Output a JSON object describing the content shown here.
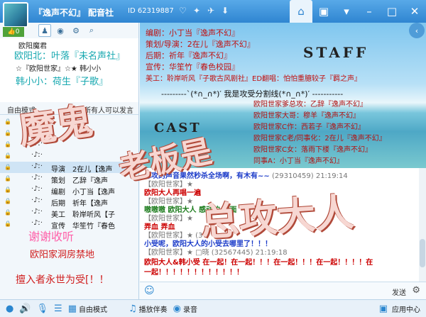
{
  "titlebar": {
    "title": "『逸声不幻』",
    "subtitle": "配音社",
    "id": "ID 62319887"
  },
  "left": {
    "like": "0",
    "header": {
      "line1": "欧阳魔君",
      "line2": "欧阳北：叶落『未名声社』",
      "line3": "☆『欧阳世家』☆★ 韩小小",
      "line4": "韩小小：荷生『子歌』"
    },
    "mode": {
      "left": "自由模式",
      "right": "所有人可以发言"
    },
    "members": [
      {
        "mark": "·♪ː·",
        "role": "",
        "nick": ""
      },
      {
        "mark": "·♪ː·",
        "role": "",
        "nick": ""
      },
      {
        "mark": "·♪ː·",
        "role": "",
        "nick": ""
      },
      {
        "mark": "·♪ː·",
        "role": "",
        "nick": ""
      },
      {
        "mark": "·♪ː·",
        "role": "导演",
        "nick": "2在儿【逸声"
      },
      {
        "mark": "·♪ː·",
        "role": "策划",
        "nick": "乙辞『逸声"
      },
      {
        "mark": "·♪ː·",
        "role": "编剧",
        "nick": "小丁当【逸声"
      },
      {
        "mark": "·♪ː·",
        "role": "后期",
        "nick": "祈年【逸声"
      },
      {
        "mark": "·♪ː·",
        "role": "美工",
        "nick": "聆岸听风【子"
      },
      {
        "mark": "·♪ː·",
        "role": "宣传",
        "nick": "华笙竹『春色"
      }
    ],
    "slogan1": "谢谢收听",
    "slogan2": "欧阳家洞房禁地",
    "slogan3": "擅入者永世为受[！！"
  },
  "banner": {
    "line1": "编剧：小丁当『逸声不幻』",
    "line2": "策划/导演：2在儿『逸声不幻』",
    "line3": "后期：祈年『逸声不幻』",
    "line4": "宣传：华笙竹『春色校园』",
    "line5": "美工：聆岸听风『子歌古风剧社』ED翻唱：怕怕重臆较子『羁之声』",
    "staff": "STAFF",
    "divider": "---------`(*∩_∩*)′ 我是攻受分割线(*∩_∩*)′ -----------",
    "cast_word": "CAST",
    "cast": [
      "欧阳世家爹总攻：乙辞『逸声不幻』",
      "欧阳世家大哥：穆羊『逸声不幻』",
      "欧阳世家C作：西若子『逸声不幻』",
      "欧阳世家C老/同事化：2在儿『逸声不幻』",
      "欧阳世家C女：落雨下楼『逸声不幻』",
      "同事A：小丁当『逸声不幻』"
    ]
  },
  "chat": {
    "lines": [
      {
        "name": "总攻",
        "msg": "的声音果然秒杀全场啊，有木有~~",
        "meta": "(29310459) 21:19:14",
        "style": "blue"
      },
      {
        "name": "【欧阳世家】★",
        "msg": "",
        "meta": "",
        "style": ""
      },
      {
        "name": "",
        "msg": "欧阳大人再唱一遍",
        "meta": "",
        "style": "red"
      },
      {
        "name": "【欧阳世家】★",
        "msg": "",
        "meta": "",
        "style": ""
      },
      {
        "name": "",
        "msg": "嗷嗷嗷 欧阳大人 感动的 满面",
        "meta": "",
        "style": ""
      },
      {
        "name": "【欧阳世家】★",
        "msg": "",
        "meta": "",
        "style": ""
      },
      {
        "name": "",
        "msg": "弄血 弄血",
        "meta": "",
        "style": "red"
      },
      {
        "name": "【欧阳世家】★",
        "msg": "",
        "meta": "(3",
        "style": ""
      },
      {
        "name": "",
        "msg": "小受呢，欧阳大人的小受去哪里了！！！",
        "meta": "",
        "style": "blue"
      },
      {
        "name": "【欧阳世家】★",
        "msg": "",
        "meta": "□晓 (32567445) 21:19:18",
        "style": ""
      },
      {
        "name": "",
        "msg": "欧阳大人&韩小受 在一起！在一起！！！在一起！！！在一起！！！！在",
        "meta": "",
        "style": "red"
      },
      {
        "name": "",
        "msg": "一起！！！！！！！！！！！！",
        "meta": "",
        "style": "red"
      }
    ],
    "send": "发送"
  },
  "bottom": {
    "free_mode": "自由模式",
    "play": "播放伴奏",
    "record": "录音",
    "app_center": "应用中心"
  },
  "overlay": {
    "word1": "魔鬼",
    "word2": "老板是",
    "word3": "总攻大人"
  }
}
